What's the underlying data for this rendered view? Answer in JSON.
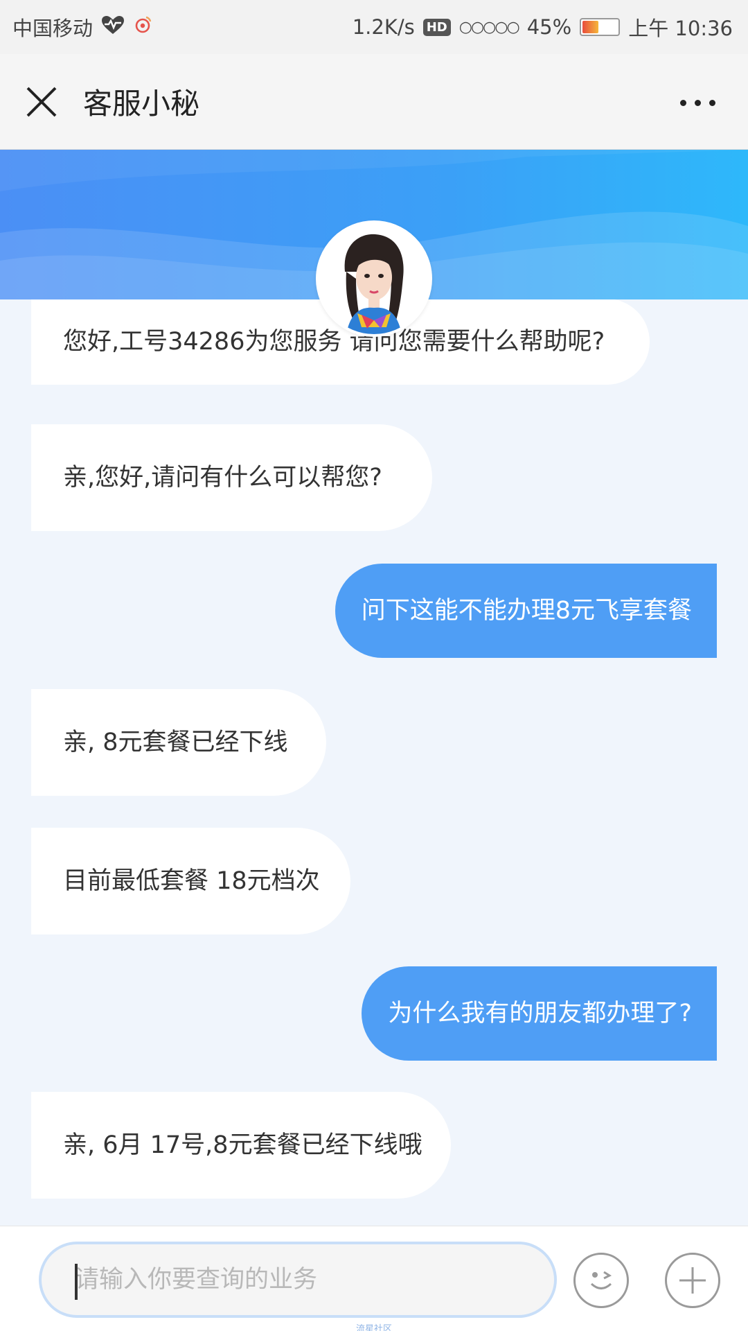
{
  "status_bar": {
    "carrier": "中国移动",
    "net_speed": "1.2K/s",
    "hd": "HD",
    "signal": "○○○○○",
    "battery_percent": "45%",
    "battery_level": 0.45,
    "time": "上午 10:36"
  },
  "nav": {
    "title": "客服小秘",
    "close_icon": "close-icon",
    "more_icon": "more-icon"
  },
  "messages": [
    {
      "from": "agent",
      "text": "您好,工号34286为您服务 请问您需要什么帮助呢?"
    },
    {
      "from": "agent",
      "text": "亲,您好,请问有什么可以帮您?"
    },
    {
      "from": "user",
      "text": "问下这能不能办理8元飞享套餐"
    },
    {
      "from": "agent",
      "text": "亲, 8元套餐已经下线"
    },
    {
      "from": "agent",
      "text": "目前最低套餐 18元档次"
    },
    {
      "from": "user",
      "text": "为什么我有的朋友都办理了?"
    },
    {
      "from": "agent",
      "text": "亲, 6月 17号,8元套餐已经下线哦"
    }
  ],
  "input": {
    "placeholder": "请输入你要查询的业务",
    "value": ""
  },
  "footer": {
    "watermark": "流星社区"
  },
  "colors": {
    "user_bubble": "#4f9ef5",
    "agent_bubble": "#ffffff",
    "chat_bg": "#f0f5fc",
    "banner_start": "#4b8ff5",
    "banner_end": "#2eb8fa"
  }
}
